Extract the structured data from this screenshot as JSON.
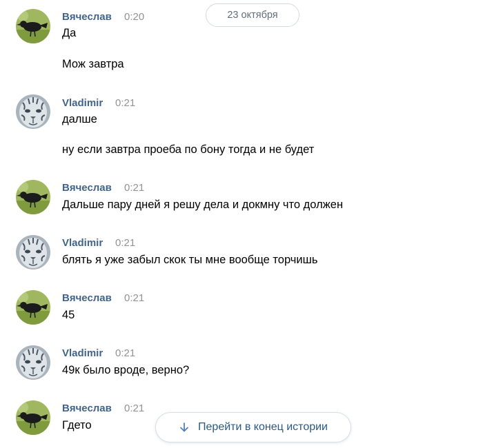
{
  "date_separator": "23 октября",
  "jump_button": {
    "label": "Перейти в конец истории",
    "icon": "arrow-down-icon"
  },
  "colors": {
    "author": "#42648b",
    "time": "#939393",
    "link": "#2a5885"
  },
  "messages": [
    {
      "author": "Вячеслав",
      "time": "0:20",
      "avatar": "crow-avatar",
      "lines": [
        "Да",
        "Мож завтра"
      ]
    },
    {
      "author": "Vladimir",
      "time": "0:21",
      "avatar": "tiger-avatar",
      "lines": [
        "далше",
        "ну если завтра проеба по бону тогда и не будет"
      ]
    },
    {
      "author": "Вячеслав",
      "time": "0:21",
      "avatar": "crow-avatar",
      "lines": [
        "Дальше пару дней я решу дела и докмну что должен"
      ]
    },
    {
      "author": "Vladimir",
      "time": "0:21",
      "avatar": "tiger-avatar",
      "lines": [
        "блять я уже забыл скок ты мне вообще торчишь"
      ]
    },
    {
      "author": "Вячеслав",
      "time": "0:21",
      "avatar": "crow-avatar",
      "lines": [
        "45"
      ]
    },
    {
      "author": "Vladimir",
      "time": "0:21",
      "avatar": "tiger-avatar",
      "lines": [
        "49к было вроде, верно?"
      ]
    },
    {
      "author": "Вячеслав",
      "time": "0:21",
      "avatar": "crow-avatar",
      "lines": [
        "Гдето"
      ]
    }
  ]
}
